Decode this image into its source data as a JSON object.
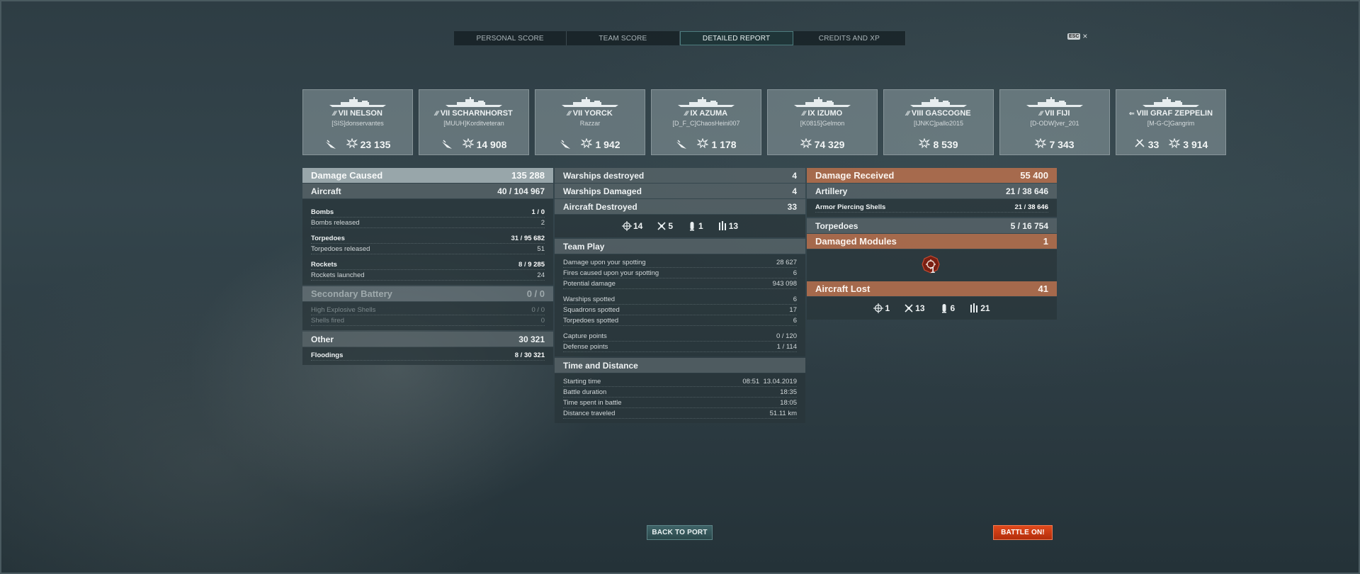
{
  "tabs": [
    {
      "label": "PERSONAL SCORE",
      "active": false
    },
    {
      "label": "TEAM SCORE",
      "active": false
    },
    {
      "label": "DETAILED REPORT",
      "active": true
    },
    {
      "label": "CREDITS AND XP",
      "active": false
    }
  ],
  "esc": {
    "key": "ESC",
    "close": "×"
  },
  "ships": [
    {
      "cls": "⁄⁄⁄",
      "name": "VII NELSON",
      "player": "[SIS]donservantes",
      "icon": "aircraft-damage-icon",
      "value": "23 135"
    },
    {
      "cls": "⁄⁄⁄",
      "name": "VII SCHARNHORST",
      "player": "[MUUH]Korditveteran",
      "icon": "aircraft-damage-icon",
      "value": "14 908"
    },
    {
      "cls": "⁄⁄⁄",
      "name": "VII YORCK",
      "player": "Razzar",
      "icon": "aircraft-damage-icon",
      "value": "1 942"
    },
    {
      "cls": "⁄⁄⁄",
      "name": "IX AZUMA",
      "player": "[D_F_C]ChaosHeini007",
      "icon": "aircraft-damage-icon",
      "value": "1 178"
    },
    {
      "cls": "⁄⁄⁄",
      "name": "IX IZUMO",
      "player": "[K0815]Gelmon",
      "icon": "",
      "value": "74 329"
    },
    {
      "cls": "⁄⁄⁄",
      "name": "VIII GASCOGNE",
      "player": "[IJNKC]pallo2015",
      "icon": "",
      "value": "8 539"
    },
    {
      "cls": "⁄⁄⁄",
      "name": "VII FIJI",
      "player": "[D-ODW]ver_201",
      "icon": "",
      "value": "7 343"
    },
    {
      "cls": "⇐",
      "name": "VIII GRAF ZEPPELIN",
      "player": "[M-G-C]Gangrim",
      "icon": "aircraft-shotdown-icon",
      "extra": "33",
      "value": "3 914"
    }
  ],
  "left": {
    "damage_caused": {
      "label": "Damage Caused",
      "value": "135 288"
    },
    "aircraft": {
      "label": "Aircraft",
      "value_a": "40 / ",
      "value_b": "104 967"
    },
    "bombs": {
      "label": "Bombs",
      "value_a": "1 / ",
      "value_b": "0"
    },
    "bombs_released": {
      "label": "Bombs released",
      "value": "2"
    },
    "torpedoes": {
      "label": "Torpedoes",
      "value_a": "31 / ",
      "value_b": "95 682"
    },
    "torpedoes_released": {
      "label": "Torpedoes released",
      "value": "51"
    },
    "rockets": {
      "label": "Rockets",
      "value_a": "8 / ",
      "value_b": "9 285"
    },
    "rockets_launched": {
      "label": "Rockets launched",
      "value": "24"
    },
    "secondary": {
      "label": "Secondary Battery",
      "value": "0 / 0"
    },
    "he_shells": {
      "label": "High Explosive Shells",
      "value": "0 / 0"
    },
    "shells_fired": {
      "label": "Shells fired",
      "value": "0"
    },
    "other": {
      "label": "Other",
      "value": "30 321"
    },
    "floodings": {
      "label": "Floodings",
      "value_a": "8 / ",
      "value_b": "30 321"
    }
  },
  "mid": {
    "warships_destroyed": {
      "label": "Warships destroyed",
      "value": "4"
    },
    "warships_damaged": {
      "label": "Warships Damaged",
      "value": "4"
    },
    "aircraft_destroyed": {
      "label": "Aircraft Destroyed",
      "value": "33"
    },
    "aircraft_icons": [
      "14",
      "5",
      "1",
      "13"
    ],
    "team_play": {
      "label": "Team Play"
    },
    "spotting_damage": {
      "label": "Damage upon your spotting",
      "value": "28 627"
    },
    "spotting_fires": {
      "label": "Fires caused upon your spotting",
      "value": "6"
    },
    "potential_damage": {
      "label": "Potential damage",
      "value": "943 098"
    },
    "warships_spotted": {
      "label": "Warships spotted",
      "value": "6"
    },
    "squadrons_spotted": {
      "label": "Squadrons spotted",
      "value": "17"
    },
    "torpedoes_spotted": {
      "label": "Torpedoes spotted",
      "value": "6"
    },
    "capture_points": {
      "label": "Capture points",
      "value": "0 / 120"
    },
    "defense_points": {
      "label": "Defense points",
      "value": "1 / 114"
    },
    "time_distance": {
      "label": "Time and Distance"
    },
    "starting_time": {
      "label": "Starting time",
      "value": "08:51  13.04.2019"
    },
    "battle_duration": {
      "label": "Battle duration",
      "value": "18:35"
    },
    "time_spent": {
      "label": "Time spent in battle",
      "value": "18:05"
    },
    "distance": {
      "label": "Distance traveled",
      "value": "51.11 km"
    }
  },
  "right": {
    "damage_received": {
      "label": "Damage Received",
      "value": "55 400"
    },
    "artillery": {
      "label": "Artillery",
      "value_a": "21 / ",
      "value_b": "38 646"
    },
    "ap_shells": {
      "label": "Armor Piercing Shells",
      "value_a": "21 / ",
      "value_b": "38 646"
    },
    "torpedoes": {
      "label": "Torpedoes",
      "value_a": "5 / ",
      "value_b": "16 754"
    },
    "damaged_modules": {
      "label": "Damaged Modules",
      "value": "1"
    },
    "module_count": "1",
    "aircraft_lost": {
      "label": "Aircraft Lost",
      "value": "41"
    },
    "lost_icons": [
      "1",
      "13",
      "6",
      "21"
    ]
  },
  "buttons": {
    "back": "BACK TO PORT",
    "battle": "BATTLE ON!"
  },
  "colors": {
    "accent_orange": "#b56e4c",
    "battle_red": "#d23f14",
    "active_tab": "#1f3538"
  }
}
